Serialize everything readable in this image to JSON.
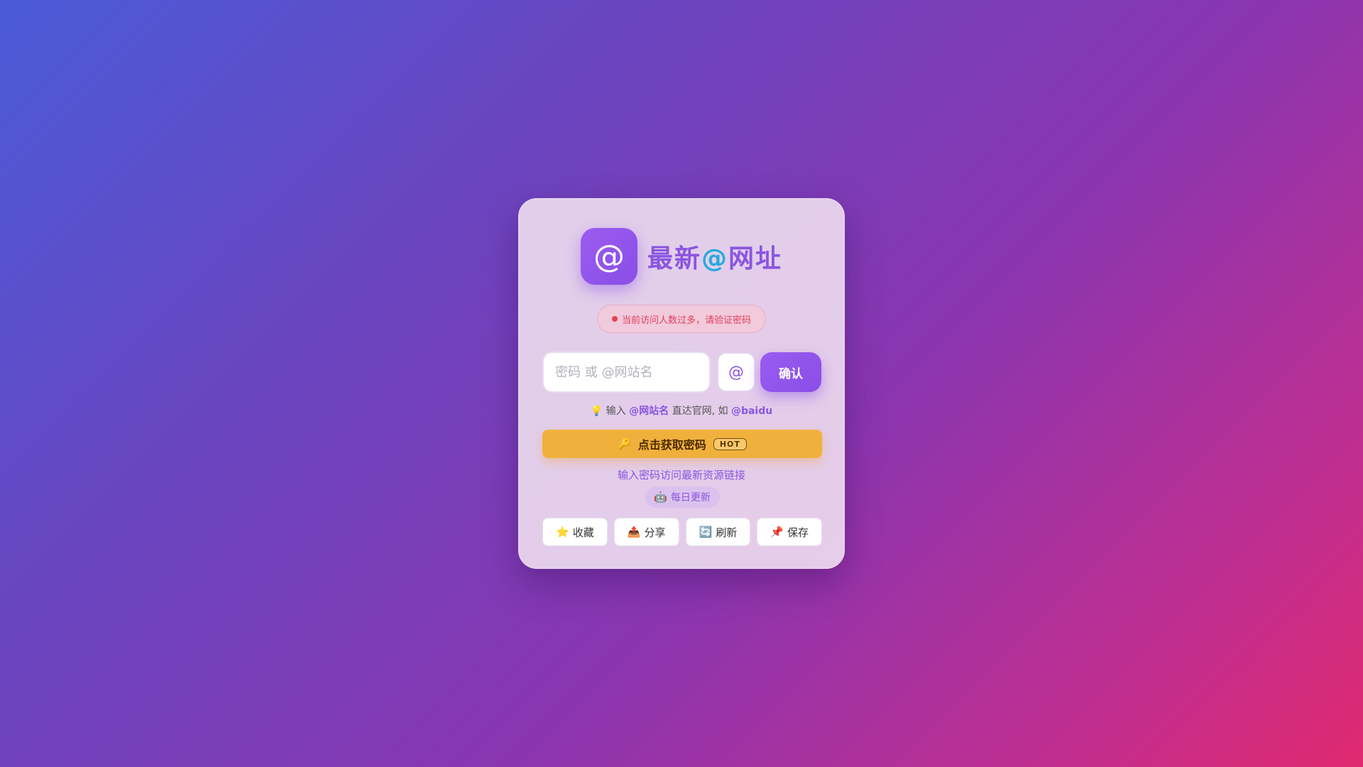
{
  "brand": {
    "logo_symbol": "@",
    "title_part1": "最新",
    "title_part2": "@",
    "title_part3": "网址"
  },
  "alert": {
    "text": "当前访问人数过多，请验证密码"
  },
  "form": {
    "placeholder": "密码 或 @网站名",
    "value": "",
    "at_label": "@",
    "confirm_label": "确认"
  },
  "tip": {
    "icon": "💡",
    "prefix": "输入",
    "keyword": "@网站名",
    "middle": "直达官网, 如",
    "example": "@baidu"
  },
  "get_password": {
    "icon": "🔑",
    "label": "点击获取密码",
    "badge": "HOT"
  },
  "subtitle": "输入密码访问最新资源链接",
  "daily": {
    "icon": "🤖",
    "label": "每日更新"
  },
  "actions": [
    {
      "icon": "⭐",
      "label": "收藏"
    },
    {
      "icon": "📤",
      "label": "分享"
    },
    {
      "icon": "🔄",
      "label": "刷新"
    },
    {
      "icon": "📌",
      "label": "保存"
    }
  ],
  "colors": {
    "accent": "#8a55e0",
    "accent_alt": "#22aadd",
    "alert": "#e0405a",
    "hot": "#f0b03c"
  }
}
